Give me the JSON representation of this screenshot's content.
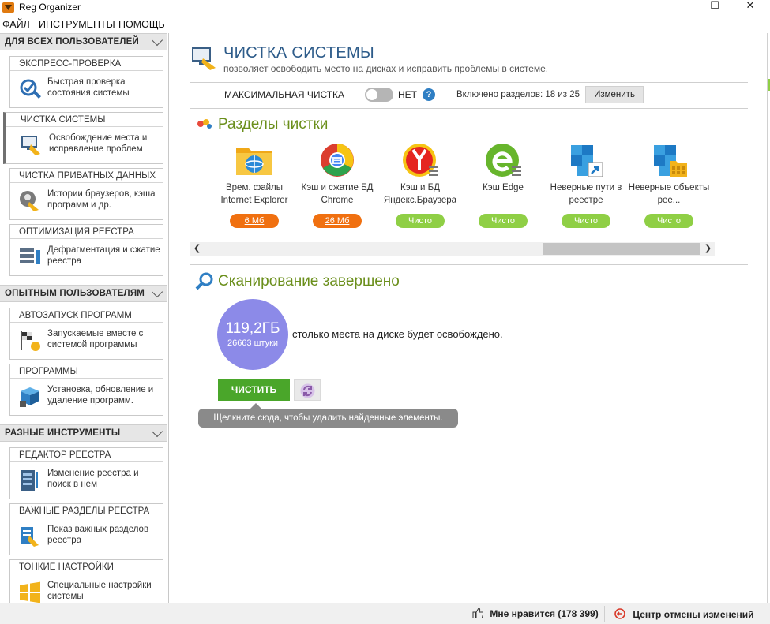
{
  "window": {
    "title": "Reg Organizer",
    "minimize": "—",
    "maximize": "☐",
    "close": "✕"
  },
  "menu": [
    "ФАЙЛ",
    "ИНСТРУМЕНТЫ",
    "ПОМОЩЬ"
  ],
  "sidebar": {
    "groups": [
      {
        "label": "ДЛЯ ВСЕХ ПОЛЬЗОВАТЕЛЕЙ",
        "items": [
          {
            "title": "ЭКСПРЕСС-ПРОВЕРКА",
            "desc": "Быстрая проверка состояния системы",
            "icon": "check-magnifier-icon"
          },
          {
            "title": "ЧИСТКА СИСТЕМЫ",
            "desc": "Освобождение места и исправление проблем",
            "icon": "broom-monitor-icon",
            "active": true
          },
          {
            "title": "ЧИСТКА ПРИВАТНЫХ ДАННЫХ",
            "desc": "Истории браузеров, кэша программ и др.",
            "icon": "private-data-icon"
          },
          {
            "title": "ОПТИМИЗАЦИЯ РЕЕСТРА",
            "desc": "Дефрагментация и сжатие реестра",
            "icon": "registry-optimize-icon"
          }
        ]
      },
      {
        "label": "ОПЫТНЫМ ПОЛЬЗОВАТЕЛЯМ",
        "items": [
          {
            "title": "АВТОЗАПУСК ПРОГРАММ",
            "desc": "Запускаемые вместе с системой программы",
            "icon": "autorun-flag-icon"
          },
          {
            "title": "ПРОГРАММЫ",
            "desc": "Установка, обновление и удаление программ.",
            "icon": "programs-box-icon"
          }
        ]
      },
      {
        "label": "РАЗНЫЕ ИНСТРУМЕНТЫ",
        "items": [
          {
            "title": "РЕДАКТОР РЕЕСТРА",
            "desc": "Изменение реестра и поиск в нем",
            "icon": "registry-editor-icon"
          },
          {
            "title": "ВАЖНЫЕ РАЗДЕЛЫ РЕЕСТРА",
            "desc": "Показ важных разделов реестра",
            "icon": "important-keys-icon"
          },
          {
            "title": "ТОНКИЕ НАСТРОЙКИ",
            "desc": "Специальные настройки системы",
            "icon": "windows-logo-icon"
          }
        ]
      }
    ]
  },
  "main": {
    "title": "ЧИСТКА СИСТЕМЫ",
    "subtitle": "позволяет освободить место на дисках и исправить проблемы в системе.",
    "max_clean_label": "МАКСИМАЛЬНАЯ ЧИСТКА",
    "max_clean_state": "НЕТ",
    "help": "?",
    "sections_enabled": "Включено разделов: 18 из 25",
    "change_button": "Изменить",
    "sections_title": "Разделы чистки",
    "tiles": [
      {
        "label": "Врем. файлы Internet Explorer",
        "badge": "6 Мб",
        "badge_kind": "orange",
        "icon": "ie-folder-icon"
      },
      {
        "label": "Кэш и сжатие БД Chrome",
        "badge": "26 Мб",
        "badge_kind": "orange",
        "icon": "chrome-icon"
      },
      {
        "label": "Кэш и БД Яндекс.Браузера",
        "badge": "Чисто",
        "badge_kind": "green",
        "icon": "yandex-browser-icon"
      },
      {
        "label": "Кэш Edge",
        "badge": "Чисто",
        "badge_kind": "green",
        "icon": "edge-icon"
      },
      {
        "label": "Неверные пути в реестре",
        "badge": "Чисто",
        "badge_kind": "green",
        "icon": "registry-paths-icon"
      },
      {
        "label": "Неверные объекты рее...",
        "badge": "Чисто",
        "badge_kind": "green",
        "icon": "registry-objects-icon"
      }
    ],
    "scan_title": "Сканирование завершено",
    "result_size": "119,2ГБ",
    "result_count": "26663 штуки",
    "result_text": "столько места на диске будет освобождено.",
    "clean_button": "ЧИСТИТЬ",
    "tooltip": "Щелкните сюда, чтобы удалить найденные элементы."
  },
  "status": {
    "likes": "Мне нравится (178 399)",
    "undo_center": "Центр отмены изменений"
  },
  "colors": {
    "title_blue": "#2e5c8a",
    "section_green": "#6b8f1c",
    "orange_badge": "#f07010",
    "green_badge": "#8fcf45",
    "result_circle": "#8c8ae8",
    "clean_button": "#4aa62a"
  }
}
